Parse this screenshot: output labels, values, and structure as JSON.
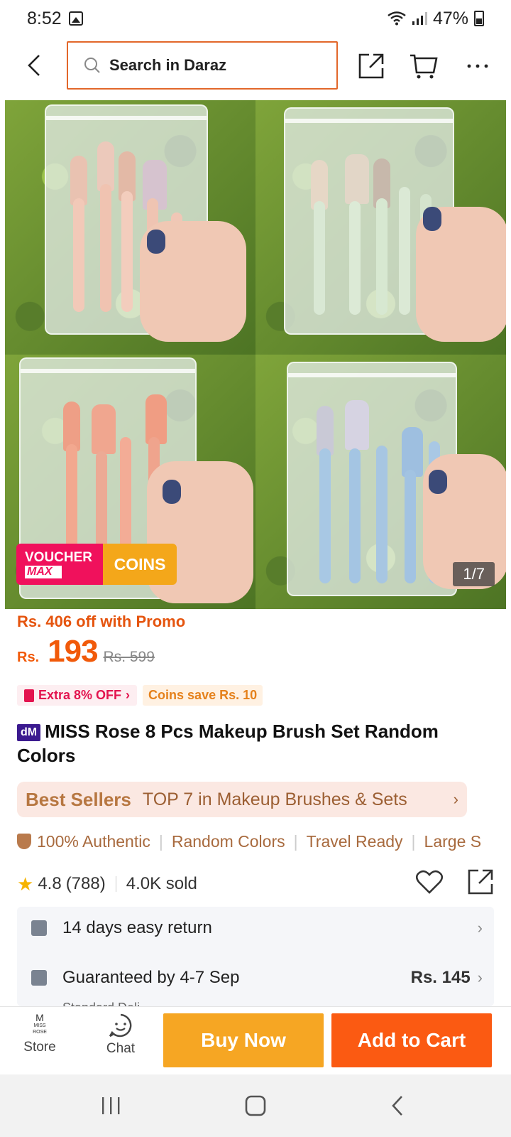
{
  "status_bar": {
    "time": "8:52",
    "battery": "47%"
  },
  "search": {
    "placeholder": "Search in Daraz"
  },
  "gallery": {
    "counter": "1/7",
    "voucher_line1": "VOUCHER",
    "voucher_line2": "MAX",
    "coins_label": "COINS"
  },
  "price": {
    "promo_text": "Rs. 406 off with Promo",
    "currency": "Rs.",
    "current": "193",
    "original": "Rs. 599"
  },
  "tags": {
    "extra_off": "Extra 8% OFF",
    "coins_save": "Coins save Rs. 10"
  },
  "product": {
    "badge": "dM",
    "title": "MISS Rose 8 Pcs Makeup Brush Set Random Colors"
  },
  "best_seller": {
    "label": "Best Sellers",
    "text": "TOP 7 in Makeup Brushes & Sets"
  },
  "features": [
    "100% Authentic",
    "Random Colors",
    "Travel Ready",
    "Large S"
  ],
  "rating": {
    "score": "4.8",
    "reviews": "(788)",
    "sold": "4.0K sold"
  },
  "services": {
    "return_text": "14 days easy return",
    "delivery_text": "Guaranteed by 4-7 Sep",
    "delivery_fee": "Rs. 145",
    "delivery_sub": "Standard Deli..."
  },
  "bottom_bar": {
    "store_label": "Store",
    "store_logo_text": "MISS ROSE",
    "chat_label": "Chat",
    "buy_now": "Buy Now",
    "add_to_cart": "Add to Cart"
  },
  "colors": {
    "accent": "#f15a0a",
    "buy_now": "#f6a623",
    "add_to_cart": "#fb5a12",
    "voucher": "#f0115c"
  }
}
